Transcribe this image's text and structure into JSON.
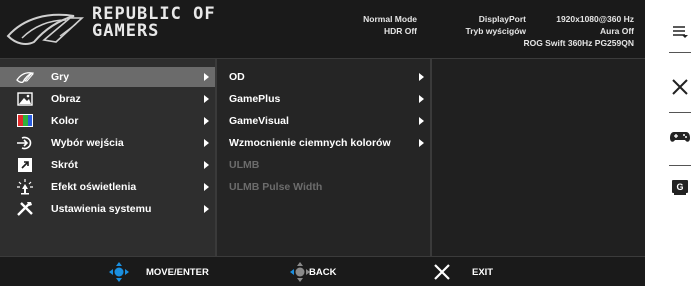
{
  "brand": {
    "line1": "REPUBLIC OF",
    "line2": "GAMERS"
  },
  "status": {
    "mode": "Normal Mode",
    "hdr": "HDR Off",
    "input": "DisplayPort",
    "resolution": "1920x1080@360 Hz",
    "racing": "Tryb wyścigów",
    "aura": "Aura Off",
    "model": "ROG Swift 360Hz PG259QN"
  },
  "menu": [
    {
      "label": "Gry",
      "icon": "rog-eye-icon",
      "selected": true
    },
    {
      "label": "Obraz",
      "icon": "image-icon"
    },
    {
      "label": "Kolor",
      "icon": "color-icon"
    },
    {
      "label": "Wybór wejścia",
      "icon": "input-icon"
    },
    {
      "label": "Skrót",
      "icon": "shortcut-icon"
    },
    {
      "label": "Efekt oświetlenia",
      "icon": "lighting-icon"
    },
    {
      "label": "Ustawienia systemu",
      "icon": "tools-icon"
    }
  ],
  "submenu": [
    {
      "label": "OD",
      "enabled": true
    },
    {
      "label": "GamePlus",
      "enabled": true
    },
    {
      "label": "GameVisual",
      "enabled": true
    },
    {
      "label": "Wzmocnienie ciemnych kolorów",
      "enabled": true
    },
    {
      "label": "ULMB",
      "enabled": false
    },
    {
      "label": "ULMB Pulse Width",
      "enabled": false
    }
  ],
  "footer": {
    "move": "MOVE/ENTER",
    "back": "BACK",
    "exit": "EXIT"
  },
  "sidebar": [
    "menu-icon",
    "close-icon",
    "gamepad-icon",
    "gameplus-icon"
  ],
  "sidebar_badge": "G",
  "colors": {
    "highlight": "#6b6b6b",
    "nav_blue": "#1a8fe0",
    "background": "#1d1d1d",
    "disabled": "#6c6c6c"
  }
}
